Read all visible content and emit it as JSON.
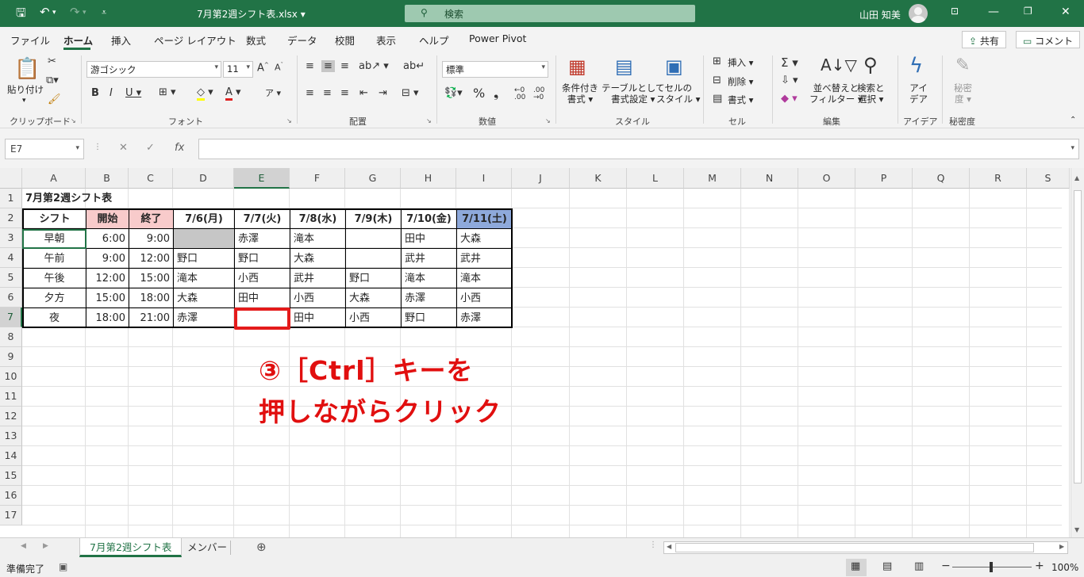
{
  "window": {
    "title": "7月第2週シフト表.xlsx",
    "search_placeholder": "検索",
    "user": "山田 知美"
  },
  "ribbon_tabs": [
    "ファイル",
    "ホーム",
    "挿入",
    "ページ レイアウト",
    "数式",
    "データ",
    "校閲",
    "表示",
    "ヘルプ",
    "Power Pivot"
  ],
  "share_label": "共有",
  "comment_label": "コメント",
  "ribbon": {
    "paste": "貼り付け",
    "font_name": "游ゴシック",
    "font_size": "11",
    "number_format": "標準",
    "cond_format": [
      "条件付き",
      "書式"
    ],
    "table_format": [
      "テーブルとして",
      "書式設定"
    ],
    "cell_style": [
      "セルの",
      "スタイル"
    ],
    "insert": "挿入",
    "delete": "削除",
    "format": "書式",
    "sort_filter": [
      "並べ替えと",
      "フィルター"
    ],
    "find_select": [
      "検索と",
      "選択"
    ],
    "ideas": [
      "アイ",
      "デア"
    ],
    "sensitivity": [
      "秘密",
      "度"
    ],
    "groups": [
      "クリップボード",
      "フォント",
      "配置",
      "数値",
      "スタイル",
      "セル",
      "編集",
      "アイデア",
      "秘密度"
    ]
  },
  "name_box": "E7",
  "columns": [
    "A",
    "B",
    "C",
    "D",
    "E",
    "F",
    "G",
    "H",
    "I",
    "J",
    "K",
    "L",
    "M",
    "N",
    "O",
    "P",
    "Q",
    "R",
    "S"
  ],
  "rows": [
    "1",
    "2",
    "3",
    "4",
    "5",
    "6",
    "7",
    "8",
    "9",
    "10",
    "11",
    "12",
    "13",
    "14",
    "15",
    "16",
    "17"
  ],
  "sheet": {
    "title": "7月第2週シフト表",
    "headers": [
      "シフト",
      "開始",
      "終了",
      "7/6(月)",
      "7/7(火)",
      "7/8(水)",
      "7/9(木)",
      "7/10(金)",
      "7/11(土)"
    ],
    "data": [
      [
        "早朝",
        "6:00",
        "9:00",
        "",
        "赤澤",
        "滝本",
        "",
        "田中",
        "大森"
      ],
      [
        "午前",
        "9:00",
        "12:00",
        "野口",
        "野口",
        "大森",
        "",
        "武井",
        "武井"
      ],
      [
        "午後",
        "12:00",
        "15:00",
        "滝本",
        "小西",
        "武井",
        "野口",
        "滝本",
        "滝本"
      ],
      [
        "夕方",
        "15:00",
        "18:00",
        "大森",
        "田中",
        "小西",
        "大森",
        "赤澤",
        "小西"
      ],
      [
        "夜",
        "18:00",
        "21:00",
        "赤澤",
        "",
        "田中",
        "小西",
        "野口",
        "赤澤"
      ]
    ],
    "colors": {
      "header_fill_pink": "#f8cbcb",
      "header_fill_blue": "#8ea9db",
      "selected_gray": "#c6c6c6",
      "accent": "#217346",
      "annotation": "#e10f0f"
    }
  },
  "sheet_tabs": [
    "7月第2週シフト表",
    "メンバー"
  ],
  "status": {
    "ready": "準備完了",
    "zoom": "100%"
  },
  "annotation": {
    "line1": "③［Ctrl］キーを",
    "line2": "押しながらクリック"
  }
}
